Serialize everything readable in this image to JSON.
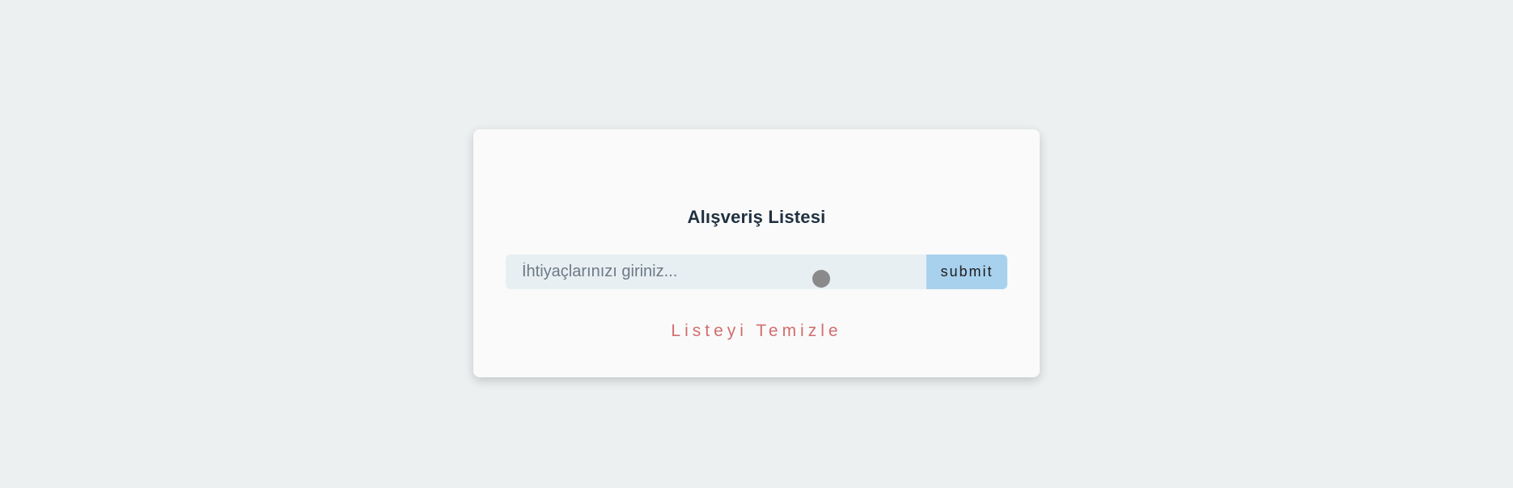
{
  "app": {
    "title": "Alışveriş Listesi"
  },
  "form": {
    "input_placeholder": "İhtiyaçlarınızı giriniz...",
    "input_value": "",
    "submit_label": "submit"
  },
  "actions": {
    "clear_label": "Listeyi Temizle"
  },
  "colors": {
    "background": "#ecf0f1",
    "card": "#fafafa",
    "title": "#1f3040",
    "submit_bg": "#a8d1ee",
    "clear_text": "#d26d6d"
  }
}
